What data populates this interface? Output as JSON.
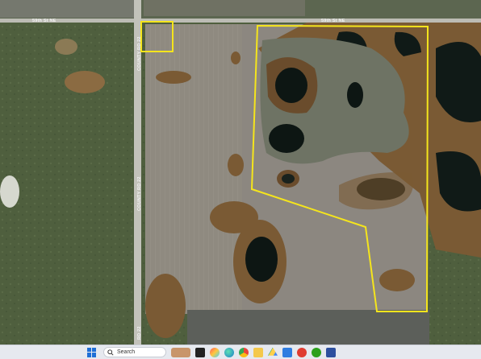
{
  "map": {
    "roads": {
      "north_road_left": "59th St NE",
      "north_road_right": "59th St NE",
      "county_road_upper": "COUNTY RD 22",
      "county_road_middle": "COUNTY RD 22",
      "county_road_lower": "RD 22"
    },
    "colors": {
      "boundary": "#f5e51c",
      "cropland": "#8f8a80",
      "water": "#101a17",
      "wetland_brown": "#7a5a34",
      "grass": "#4f5f3e"
    }
  },
  "taskbar": {
    "search_label": "Search",
    "icons": [
      "windows-start-icon",
      "search-icon",
      "widget-icon",
      "terminal-icon",
      "paint-icon",
      "edge-icon",
      "chrome-icon",
      "file-explorer-icon",
      "drive-icon",
      "store-icon",
      "security-icon",
      "quickbooks-icon",
      "app-icon"
    ]
  }
}
